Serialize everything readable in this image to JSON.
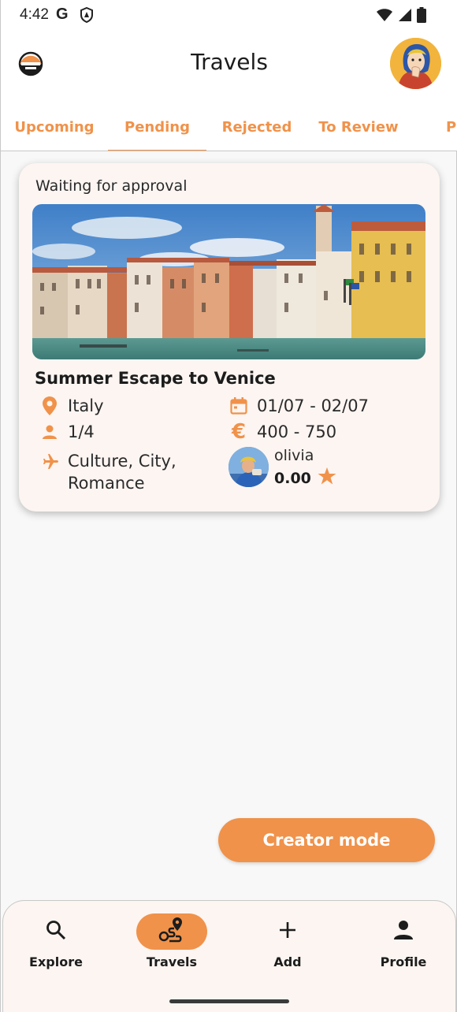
{
  "status_bar": {
    "time": "4:42",
    "g_label": "G"
  },
  "header": {
    "title": "Travels"
  },
  "tabs": [
    {
      "label": "Upcoming",
      "active": false
    },
    {
      "label": "Pending",
      "active": true
    },
    {
      "label": "Rejected",
      "active": false
    },
    {
      "label": "To Review",
      "active": false
    },
    {
      "label": "P",
      "active": false
    }
  ],
  "card": {
    "status": "Waiting for approval",
    "title": "Summer Escape to Venice",
    "location": "Italy",
    "dates": "01/07 - 02/07",
    "participants": "1/4",
    "price": "400 - 750",
    "categories_line1": "Culture, City,",
    "categories_line2": "Romance",
    "creator_name": "olivia",
    "creator_rating": "0.00"
  },
  "actions": {
    "creator_mode": "Creator mode"
  },
  "bottom_nav": [
    {
      "label": "Explore",
      "icon": "search-icon",
      "active": false
    },
    {
      "label": "Travels",
      "icon": "route-icon",
      "active": true
    },
    {
      "label": "Add",
      "icon": "plus-icon",
      "active": false
    },
    {
      "label": "Profile",
      "icon": "person-icon",
      "active": false
    }
  ],
  "colors": {
    "accent": "#f0924a",
    "card_bg": "#fcf5f2",
    "page_bg": "#f8f8f8"
  }
}
